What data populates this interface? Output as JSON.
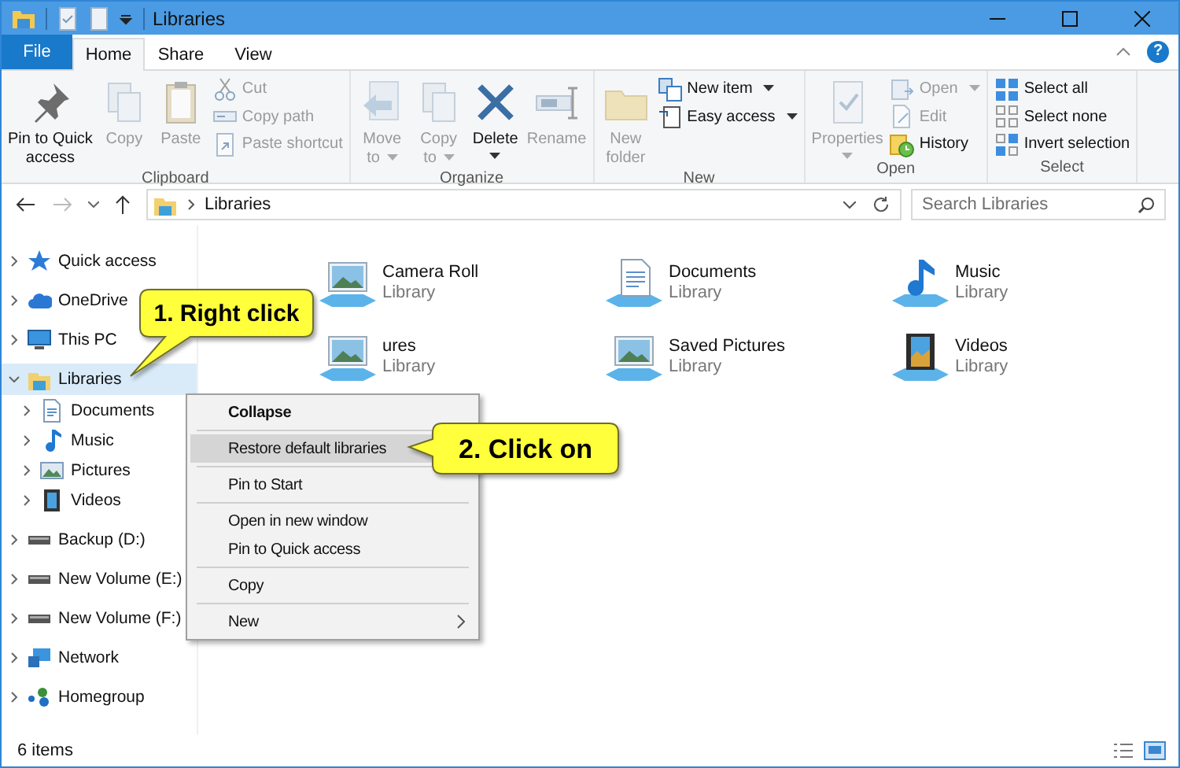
{
  "window": {
    "title": "Libraries"
  },
  "ribbon_tabs": [
    {
      "label": "File",
      "kind": "file",
      "selected": false
    },
    {
      "label": "Home",
      "kind": "tab",
      "selected": true
    },
    {
      "label": "Share",
      "kind": "tab",
      "selected": false
    },
    {
      "label": "View",
      "kind": "tab",
      "selected": false
    }
  ],
  "help": "?",
  "ribbon": [
    {
      "label": "Clipboard",
      "items": [
        {
          "kind": "large",
          "lines": [
            "Pin to Quick",
            "access"
          ],
          "dropdown": false,
          "disabled": false
        },
        {
          "kind": "large",
          "lines": [
            "Copy"
          ],
          "dropdown": false,
          "disabled": true
        },
        {
          "kind": "large",
          "lines": [
            "Paste"
          ],
          "dropdown": false,
          "disabled": true
        },
        {
          "kind": "stack",
          "items": [
            {
              "label": "Cut",
              "dropdown": false,
              "disabled": true
            },
            {
              "label": "Copy path",
              "dropdown": false,
              "disabled": true
            },
            {
              "label": "Paste shortcut",
              "dropdown": false,
              "disabled": true
            }
          ]
        }
      ]
    },
    {
      "label": "Organize",
      "items": [
        {
          "kind": "large",
          "lines": [
            "Move",
            "to"
          ],
          "dropdown": true,
          "disabled": true
        },
        {
          "kind": "large",
          "lines": [
            "Copy",
            "to"
          ],
          "dropdown": true,
          "disabled": true
        },
        {
          "kind": "large",
          "lines": [
            "Delete"
          ],
          "dropdown": true,
          "disabled": false
        },
        {
          "kind": "large",
          "lines": [
            "Rename"
          ],
          "dropdown": false,
          "disabled": true
        }
      ]
    },
    {
      "label": "New",
      "items": [
        {
          "kind": "large",
          "lines": [
            "New",
            "folder"
          ],
          "dropdown": false,
          "disabled": true
        },
        {
          "kind": "stack",
          "items": [
            {
              "label": "New item",
              "dropdown": true,
              "disabled": false
            },
            {
              "label": "Easy access",
              "dropdown": true,
              "disabled": false
            }
          ]
        }
      ]
    },
    {
      "label": "Open",
      "items": [
        {
          "kind": "large",
          "lines": [
            "Properties"
          ],
          "dropdown": true,
          "disabled": true
        },
        {
          "kind": "stack",
          "items": [
            {
              "label": "Open",
              "dropdown": true,
              "disabled": true
            },
            {
              "label": "Edit",
              "dropdown": false,
              "disabled": true
            },
            {
              "label": "History",
              "dropdown": false,
              "disabled": false
            }
          ]
        }
      ]
    },
    {
      "label": "Select",
      "items": [
        {
          "kind": "stack",
          "items": [
            {
              "label": "Select all",
              "dropdown": false,
              "disabled": false
            },
            {
              "label": "Select none",
              "dropdown": false,
              "disabled": false
            },
            {
              "label": "Invert selection",
              "dropdown": false,
              "disabled": false
            }
          ]
        }
      ]
    }
  ],
  "address": {
    "path": "Libraries"
  },
  "search": {
    "placeholder": "Search Libraries"
  },
  "navigation": [
    {
      "label": "Quick access",
      "expanded": false,
      "selected": false
    },
    {
      "label": "OneDrive",
      "expanded": false,
      "selected": false
    },
    {
      "label": "This PC",
      "expanded": false,
      "selected": false
    },
    {
      "label": "Libraries",
      "expanded": true,
      "selected": true,
      "children": [
        {
          "label": "Documents",
          "expanded": false,
          "selected": false
        },
        {
          "label": "Music",
          "expanded": false,
          "selected": false
        },
        {
          "label": "Pictures",
          "expanded": false,
          "selected": false
        },
        {
          "label": "Videos",
          "expanded": false,
          "selected": false
        }
      ]
    },
    {
      "label": "Backup (D:)",
      "expanded": false,
      "selected": false
    },
    {
      "label": "New Volume (E:)",
      "expanded": false,
      "selected": false
    },
    {
      "label": "New Volume (F:)",
      "expanded": false,
      "selected": false
    },
    {
      "label": "Network",
      "expanded": false,
      "selected": false
    },
    {
      "label": "Homegroup",
      "expanded": false,
      "selected": false
    }
  ],
  "libraries": [
    {
      "name": "Camera Roll",
      "type": "Library"
    },
    {
      "name": "Documents",
      "type": "Library"
    },
    {
      "name": "Music",
      "type": "Library"
    },
    {
      "name": "ures",
      "type": "Library"
    },
    {
      "name": "Saved Pictures",
      "type": "Library"
    },
    {
      "name": "Videos",
      "type": "Library"
    }
  ],
  "context_menu": [
    {
      "kind": "item",
      "label": "Collapse",
      "bold": true,
      "selected": false,
      "submenu": false
    },
    {
      "kind": "separator"
    },
    {
      "kind": "item",
      "label": "Restore default libraries",
      "bold": false,
      "selected": true,
      "submenu": false
    },
    {
      "kind": "separator"
    },
    {
      "kind": "item",
      "label": "Pin to Start",
      "bold": false,
      "selected": false,
      "submenu": false
    },
    {
      "kind": "separator"
    },
    {
      "kind": "item",
      "label": "Open in new window",
      "bold": false,
      "selected": false,
      "submenu": false
    },
    {
      "kind": "item",
      "label": "Pin to Quick access",
      "bold": false,
      "selected": false,
      "submenu": false
    },
    {
      "kind": "separator"
    },
    {
      "kind": "item",
      "label": "Copy",
      "bold": false,
      "selected": false,
      "submenu": false
    },
    {
      "kind": "separator"
    },
    {
      "kind": "item",
      "label": "New",
      "bold": false,
      "selected": false,
      "submenu": true
    }
  ],
  "callouts": [
    {
      "text": "1. Right click"
    },
    {
      "text": "2. Click on"
    }
  ],
  "status_bar": {
    "count": "6 items"
  }
}
